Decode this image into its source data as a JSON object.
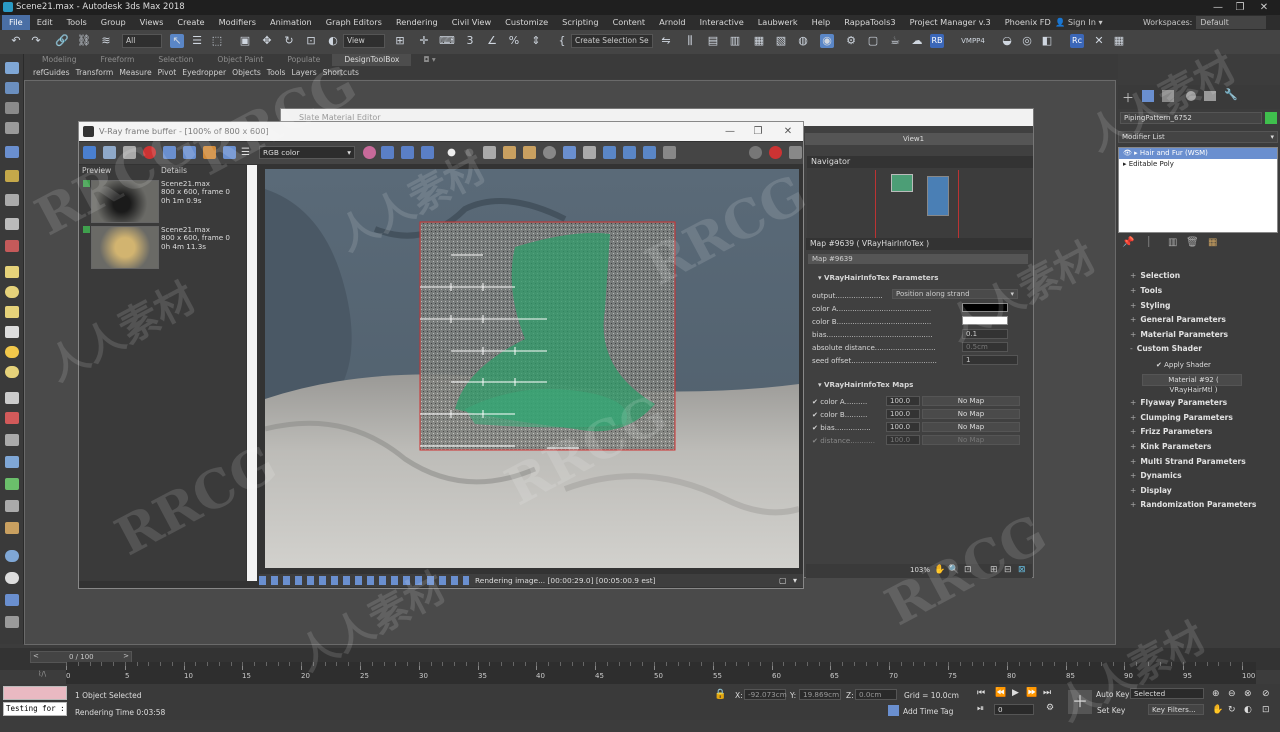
{
  "app": {
    "title": "Scene21.max - Autodesk 3ds Max 2018",
    "window_controls": [
      "—",
      "❐",
      "✕"
    ]
  },
  "menu": {
    "items": [
      "File",
      "Edit",
      "Tools",
      "Group",
      "Views",
      "Create",
      "Modifiers",
      "Animation",
      "Graph Editors",
      "Rendering",
      "Civil View",
      "Customize",
      "Scripting",
      "Content",
      "Arnold",
      "Interactive",
      "Laubwerk",
      "Help",
      "RappaTools3",
      "Project Manager v.3",
      "Phoenix FD"
    ],
    "sign_in": "Sign In",
    "workspaces_label": "Workspaces:",
    "workspaces_value": "Default"
  },
  "toolbar": {
    "filter_value": "All",
    "view_value": "View",
    "selection_set": "Create Selection Se",
    "vmpp": "VMPP4"
  },
  "ribbon": {
    "tabs": [
      "Modeling",
      "Freeform",
      "Selection",
      "Object Paint",
      "Populate",
      "DesignToolBox"
    ],
    "active": "DesignToolBox",
    "subitems": [
      "refGuides",
      "Transform",
      "Measure",
      "Pivot",
      "Eyedropper",
      "Objects",
      "Tools",
      "Layers",
      "Shortcuts"
    ]
  },
  "slate": {
    "title": "Slate Material Editor",
    "view_tab": "View1",
    "navigator_title": "Navigator"
  },
  "vfb": {
    "title": "V-Ray frame buffer - [100% of 800 x 600]",
    "channel": "RGB color",
    "history_headers": [
      "Preview",
      "Details"
    ],
    "history": [
      {
        "name": "Scene21.max",
        "res": "800 x 600, frame 0",
        "time": "0h 1m 0.9s"
      },
      {
        "name": "Scene21.max",
        "res": "800 x 600, frame 0",
        "time": "0h 4m 11.3s"
      }
    ],
    "status": "Rendering image... [00:00:29.0] [00:05:00.9 est]"
  },
  "map": {
    "header": "Map #9639  ( VRayHairInfoTex )",
    "name": "Map #9639",
    "params_title": "VRayHairInfoTex Parameters",
    "output_label": "output.....................",
    "output_value": "Position along strand",
    "color_a_label": "color A..........................................",
    "color_b_label": "color B..........................................",
    "bias_label": "bias...............................................",
    "bias_value": "0.1",
    "abs_label": "absolute distance...........................",
    "abs_value": "0.5cm",
    "seed_label": "seed offset......................................",
    "seed_value": "1",
    "color_a": "#000000",
    "color_b": "#ffffff",
    "maps_title": "VRayHairInfoTex Maps",
    "maps": [
      {
        "label": "color A..........",
        "value": "100.0",
        "map": "No Map"
      },
      {
        "label": "color B..........",
        "value": "100.0",
        "map": "No Map"
      },
      {
        "label": "bias................",
        "value": "100.0",
        "map": "No Map"
      },
      {
        "label": "distance...........",
        "value": "100.0",
        "map": "No Map"
      }
    ],
    "zoom": "103%"
  },
  "cmdpanel": {
    "object_name": "PipingPattern_6752",
    "modifier_list": "Modifier List",
    "stack": [
      "Hair and Fur (WSM)",
      "Editable Poly"
    ],
    "rollouts": [
      "Selection",
      "Tools",
      "Styling",
      "General Parameters",
      "Material Parameters",
      "Custom Shader"
    ],
    "apply_shader": "Apply Shader",
    "material": "Material #92  ( VRayHairMtl )",
    "rollouts2": [
      "Flyaway Parameters",
      "Clumping Parameters",
      "Frizz Parameters",
      "Kink Parameters",
      "Multi Strand Parameters",
      "Dynamics",
      "Display",
      "Randomization Parameters"
    ]
  },
  "timeline": {
    "frame": "0 / 100",
    "ticks": [
      "0",
      "5",
      "10",
      "15",
      "20",
      "25",
      "30",
      "35",
      "40",
      "45",
      "50",
      "55",
      "60",
      "65",
      "70",
      "75",
      "80",
      "85",
      "90",
      "95",
      "100"
    ]
  },
  "status": {
    "selected": "1 Object Selected",
    "render_time": "Rendering Time  0:03:58",
    "script_text": "Testing for :",
    "x_label": "X:",
    "x_value": "-92.073cm",
    "y_label": "Y:",
    "y_value": "19.869cm",
    "z_label": "Z:",
    "z_value": "0.0cm",
    "grid": "Grid = 10.0cm",
    "add_time_tag": "Add Time Tag",
    "auto_key": "Auto Key",
    "set_key": "Set Key",
    "selected_dd": "Selected",
    "key_filters": "Key Filters...",
    "frame_field": "0"
  },
  "watermark": {
    "brand": "RRCG",
    "cn": "人人素材"
  }
}
